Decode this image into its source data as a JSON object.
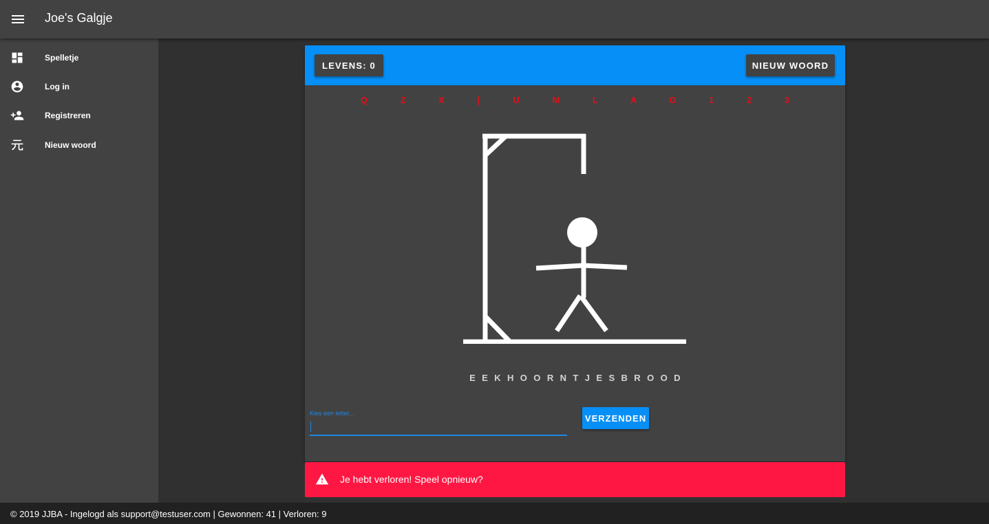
{
  "app": {
    "title": "Joe's Galgje"
  },
  "sidebar": {
    "items": [
      {
        "label": "Spelletje",
        "icon": "dashboard-icon"
      },
      {
        "label": "Log in",
        "icon": "account-circle-icon"
      },
      {
        "label": "Registreren",
        "icon": "person-add-icon"
      },
      {
        "label": "Nieuw woord",
        "icon": "yuan-glyph-icon"
      }
    ]
  },
  "game": {
    "lives_label": "LEVENS: 0",
    "new_word_label": "NIEUW WOORD",
    "guessed_letters": "Q Z X [ U M L A G 1 2 3",
    "word": "EEKHOORNTJESBROOD",
    "input_placeholder": "Kies een letter...",
    "input_value": "",
    "submit_label": "VERZENDEN",
    "lives_remaining": 0
  },
  "alert": {
    "message": "Je hebt verloren! Speel opnieuw?",
    "icon": "warning-icon"
  },
  "footer": {
    "text": "© 2019 JJBA - Ingelogd als support@testuser.com | Gewonnen: 41 | Verloren: 9"
  },
  "colors": {
    "primary": "#068ff6",
    "error": "#ff1744",
    "guessed": "#e0101a",
    "surface": "#424242",
    "background": "#303030"
  }
}
